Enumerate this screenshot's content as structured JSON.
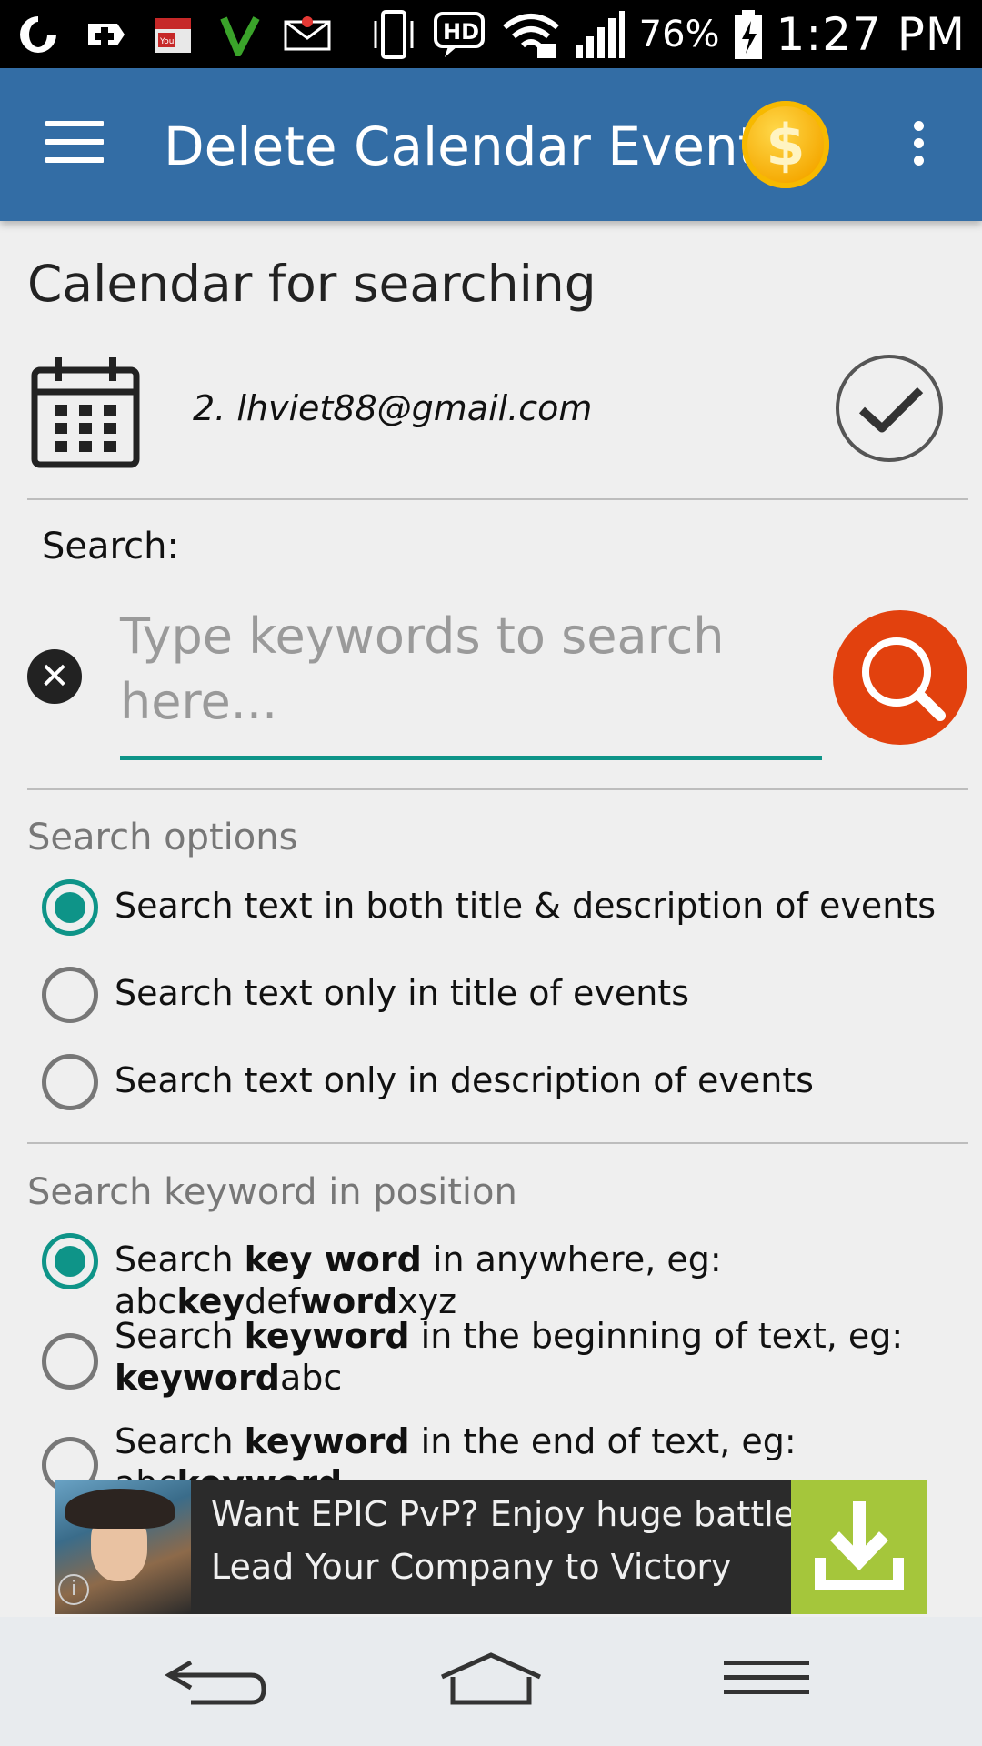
{
  "status_bar": {
    "battery_percent": "76%",
    "time": "1:27 PM",
    "hd_label": "HD",
    "notification_icons": [
      "opera-icon",
      "medical-plus-icon",
      "youtube-calendar-icon",
      "vine-icon",
      "mail-icon"
    ]
  },
  "app_bar": {
    "title": "Delete Calendar Event",
    "coin_symbol": "$"
  },
  "calendar_section": {
    "heading": "Calendar for searching",
    "account": "2. lhviet88@gmail.com"
  },
  "search": {
    "label": "Search:",
    "placeholder": "Type  keywords  to search here...",
    "clear_symbol": "✕"
  },
  "search_options": {
    "title": "Search options",
    "options": [
      {
        "label": "Search text in both title & description of events",
        "selected": true
      },
      {
        "label": "Search text only in title of events",
        "selected": false
      },
      {
        "label": "Search text only in description of events",
        "selected": false
      }
    ]
  },
  "position_options": {
    "title": "Search keyword in position",
    "options": [
      {
        "selected": true,
        "parts": [
          "Search ",
          "key word",
          " in anywhere, eg: abc",
          "key",
          "def",
          "word",
          "xyz"
        ]
      },
      {
        "selected": false,
        "parts": [
          "Search ",
          "keyword",
          " in the beginning of text, eg: ",
          "keyword",
          "abc"
        ]
      },
      {
        "selected": false,
        "parts": [
          "Search ",
          "keyword",
          " in the end of text, eg: abc",
          "keyword"
        ]
      }
    ]
  },
  "ad": {
    "line1": "Want EPIC PvP? Enjoy huge battles?",
    "line2": "Lead Your Company to Victory",
    "info_symbol": "i"
  },
  "colors": {
    "app_bar": "#336da5",
    "accent": "#0e9488",
    "search_button": "#e2410e",
    "coin": "#f5a800",
    "ad_download": "#a5c63b"
  }
}
